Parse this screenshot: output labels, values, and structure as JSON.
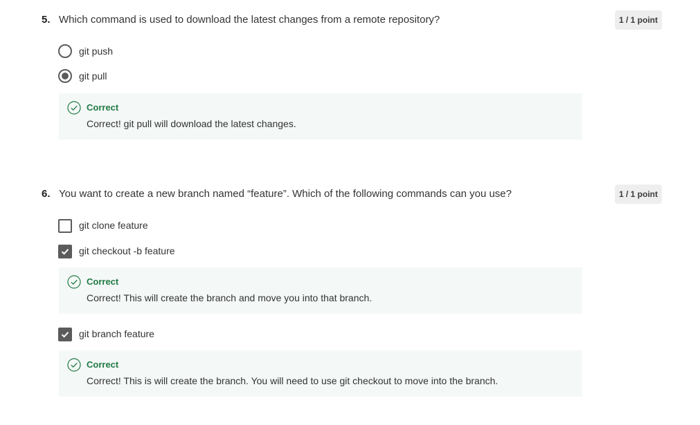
{
  "questions": [
    {
      "number": "5.",
      "text": "Which command is used to download the latest changes from a remote repository?",
      "points": "1 / 1 point",
      "options": [
        {
          "label": "git push",
          "selected": false
        },
        {
          "label": "git pull",
          "selected": true
        }
      ],
      "feedback": [
        {
          "title": "Correct",
          "text": "Correct! git pull will download the latest changes."
        }
      ]
    },
    {
      "number": "6.",
      "text": "You want to create a new branch named “feature”. Which of the following commands can you use?",
      "points": "1 / 1 point",
      "options": [
        {
          "label": "git clone feature",
          "checked": false
        },
        {
          "label": "git checkout -b feature",
          "checked": true
        },
        {
          "label": "git branch feature",
          "checked": true
        }
      ],
      "feedback": [
        {
          "title": "Correct",
          "text": "Correct! This will create the branch and move you into that branch."
        },
        {
          "title": "Correct",
          "text": "Correct! This is will create the branch. You will need to use git checkout to move into the branch."
        }
      ]
    }
  ],
  "colors": {
    "correct_accent": "#1f7a45",
    "feedback_bg": "#f4f8f6",
    "badge_bg": "#eeeeee",
    "control": "#5b5b5b"
  },
  "icons": {
    "feedback": "check-circle-icon",
    "checkbox_checked": "checkmark-icon"
  }
}
